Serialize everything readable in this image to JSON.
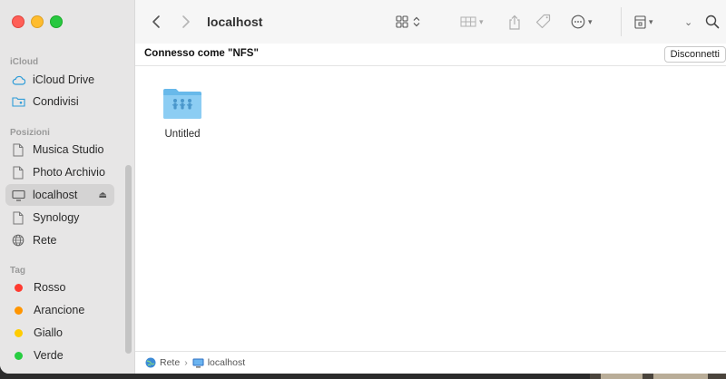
{
  "window": {
    "title": "localhost"
  },
  "sidebar": {
    "sections": [
      {
        "title": "iCloud",
        "items": [
          {
            "label": "iCloud Drive",
            "icon": "cloud-icon"
          },
          {
            "label": "Condivisi",
            "icon": "shared-folder-icon"
          }
        ]
      },
      {
        "title": "Posizioni",
        "items": [
          {
            "label": "Musica Studio",
            "icon": "document-icon"
          },
          {
            "label": "Photo Archivio",
            "icon": "document-icon"
          },
          {
            "label": "localhost",
            "icon": "display-icon",
            "selected": true
          },
          {
            "label": "Synology",
            "icon": "document-icon"
          },
          {
            "label": "Rete",
            "icon": "globe-icon"
          }
        ]
      },
      {
        "title": "Tag",
        "items": [
          {
            "label": "Rosso",
            "color": "#ff3b30"
          },
          {
            "label": "Arancione",
            "color": "#ff9500"
          },
          {
            "label": "Giallo",
            "color": "#ffcc00"
          },
          {
            "label": "Verde",
            "color": "#28cd41"
          }
        ]
      }
    ]
  },
  "connection": {
    "label": "Connesso come \"NFS\"",
    "disconnect_label": "Disconnetti"
  },
  "content": {
    "items": [
      {
        "label": "Untitled",
        "icon": "shared-folder-icon"
      }
    ]
  },
  "pathbar": {
    "segments": [
      {
        "label": "Rete",
        "icon": "network-globe-icon"
      },
      {
        "label": "localhost",
        "icon": "display-icon"
      }
    ]
  }
}
